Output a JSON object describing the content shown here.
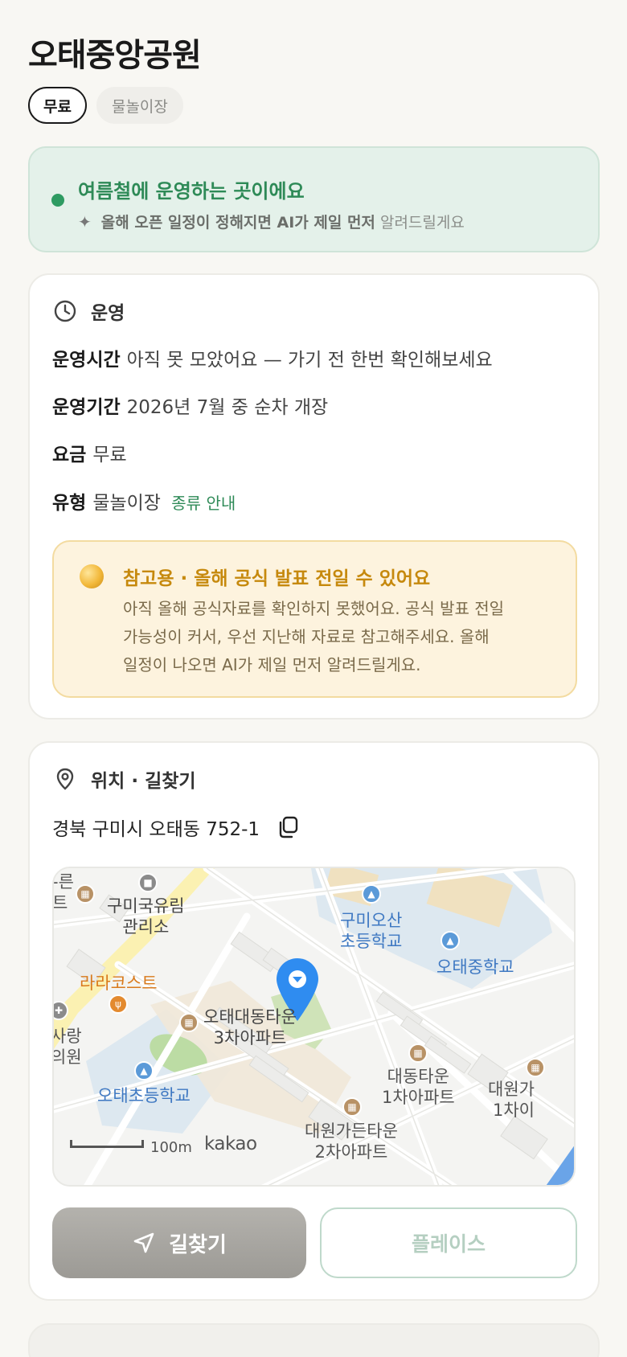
{
  "header": {
    "title": "오태중앙공원",
    "chips": [
      "무료",
      "물놀이장"
    ]
  },
  "season": {
    "title": "여름철에 운영하는 곳이에요",
    "sparkle_icon": "sparkle-icon",
    "sub_bold": "올해 오픈 일정이 정해지면 AI가 제일 먼저",
    "sub_light": "알려드릴게요"
  },
  "operation": {
    "heading": "운영",
    "icon": "clock-icon",
    "rows": [
      {
        "key": "운영시간",
        "value": "아직 못 모았어요 — 가기 전 한번 확인해보세요"
      },
      {
        "key": "운영기간",
        "value": "2026년 7월 중 순차 개장"
      },
      {
        "key": "요금",
        "value": "무료"
      },
      {
        "key": "유형",
        "value": "물놀이장",
        "link": "종류 안내"
      }
    ],
    "notice": {
      "icon": "coin-icon",
      "title": "참고용 · 올해 공식 발표 전일 수 있어요",
      "lines": [
        "아직 올해 공식자료를 확인하지 못했어요. 공식 발표 전일",
        "가능성이 커서, 우선 지난해 자료로 참고해주세요. 올해",
        "일정이 나오면 AI가 제일 먼저 알려드릴게요."
      ]
    }
  },
  "location": {
    "heading": "위치 · 길찾기",
    "icon": "pin-icon",
    "address": "경북 구미시 오태동 752-1",
    "copy_icon": "copy-icon",
    "map": {
      "labels": {
        "cheongsonyeon": "구미국유림\n관리소",
        "osan_school": "구미오산\n초등학교",
        "otae_middle": "오태중학교",
        "larakost": "라라코스트",
        "daedong3": "오태대동타운\n3차아파트",
        "clinic": "사랑\n의원",
        "clinic_prefix": "-른\n트",
        "otae_elem": "오태초등학교",
        "daedong1": "대동타운\n1차아파트",
        "daewon2": "대원가든타운\n2차아파트",
        "daewon1": "대원가\n1차이"
      },
      "scale": "100m",
      "provider": "kakao",
      "marker_color": "#2f8cf0"
    },
    "buttons": {
      "route": "길찾기",
      "route_icon": "navigate-icon",
      "place": "플레이스"
    }
  }
}
